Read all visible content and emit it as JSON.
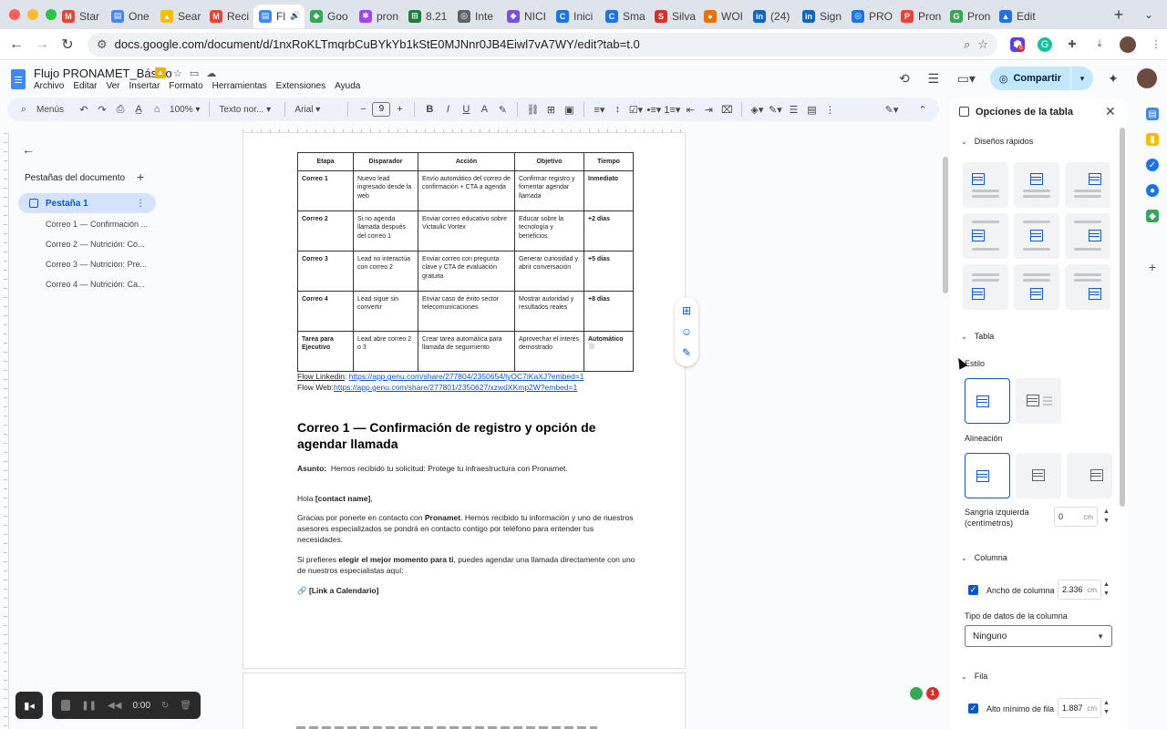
{
  "browser": {
    "tabs": [
      {
        "label": "Star",
        "color": "#ea4335",
        "glyph": "M"
      },
      {
        "label": "One",
        "color": "#4285f4",
        "glyph": "▤"
      },
      {
        "label": "Sear",
        "color": "#fbbc04",
        "glyph": "▲"
      },
      {
        "label": "Reci",
        "color": "#ea4335",
        "glyph": "M"
      },
      {
        "label": "Fl",
        "color": "#4285f4",
        "glyph": "▤",
        "active": true
      },
      {
        "label": "Goo",
        "color": "#34a853",
        "glyph": "◆"
      },
      {
        "label": "pron",
        "color": "#a142f4",
        "glyph": "✱"
      },
      {
        "label": "8.21",
        "color": "#188038",
        "glyph": "⊞"
      },
      {
        "label": "Inte",
        "color": "#5f6368",
        "glyph": "◎"
      },
      {
        "label": "NICI",
        "color": "#7b4ee2",
        "glyph": "◆"
      },
      {
        "label": "Inici",
        "color": "#1a73e8",
        "glyph": "C"
      },
      {
        "label": "Sma",
        "color": "#1a73e8",
        "glyph": "C"
      },
      {
        "label": "Silva",
        "color": "#d93025",
        "glyph": "S"
      },
      {
        "label": "WOI",
        "color": "#e8710a",
        "glyph": "●"
      },
      {
        "label": "(24)",
        "color": "#0a66c2",
        "glyph": "in"
      },
      {
        "label": "Sign",
        "color": "#0a66c2",
        "glyph": "in"
      },
      {
        "label": "PRO",
        "color": "#1a73e8",
        "glyph": "◎"
      },
      {
        "label": "Pron",
        "color": "#ea4335",
        "glyph": "P"
      },
      {
        "label": "Pron",
        "color": "#34a853",
        "glyph": "G"
      },
      {
        "label": "Edit",
        "color": "#1a73e8",
        "glyph": "▲"
      }
    ],
    "url": "docs.google.com/document/d/1nxRoKLTmqrbCuBYkYb1kStE0MJNnr0JB4Eiwl7vA7WY/edit?tab=t.0",
    "ext_badge": "6"
  },
  "docs": {
    "title": "Flujo PRONAMET_Básico",
    "menus": [
      "Archivo",
      "Editar",
      "Ver",
      "Insertar",
      "Formato",
      "Herramientas",
      "Extensiones",
      "Ayuda"
    ],
    "share_label": "Compartir"
  },
  "toolbar": {
    "search_menus": "Menús",
    "zoom": "100%",
    "style": "Texto nor...",
    "font": "Arial",
    "font_size": "9"
  },
  "outline": {
    "heading": "Pestañas del documento",
    "tab_label": "Pestaña 1",
    "items": [
      "Correo 1 — Confirmación ...",
      "Correo 2 — Nutrición: Có...",
      "Correo 3 — Nutrición: Pre...",
      "Correo 4 — Nutrición: Ca..."
    ]
  },
  "document": {
    "table": {
      "headers": [
        "Etapa",
        "Disparador",
        "Acción",
        "Objetivo",
        "Tiempo"
      ],
      "rows": [
        [
          "Correo 1",
          "Nuevo lead ingresado desde la web",
          "Envío automático del correo de confirmación + CTA a agenda",
          "Confirmar registro y fomentar agendar llamada",
          "Inmediato"
        ],
        [
          "Correo 2",
          "Si no agenda llamada después del correo 1",
          "Enviar correo educativo sobre Victaulic Vortex",
          "Educar sobre la tecnología y beneficios",
          "+2 días"
        ],
        [
          "Correo 3",
          "Lead no interactúa con correo 2",
          "Enviar correo con pregunta clave y CTA de evaluación gratuita",
          "Generar curiosidad y abrir conversación",
          "+5 días"
        ],
        [
          "Correo 4",
          "Lead sigue sin convertir",
          "Enviar caso de éxito sector telecomunicaciones",
          "Mostrar autoridad y resultados reales",
          "+8 días"
        ],
        [
          "Tarea para Ejecutivo",
          "Lead abre correo 2 o 3",
          "Crear tarea automática para llamada de seguimiento",
          "Aprovechar el interés demostrado",
          "Automático"
        ]
      ]
    },
    "flow_linkedin_label": "Flow Linkedin",
    "flow_linkedin_sep": ": ",
    "flow_linkedin_url": "https://app.genu.com/share/277804/2350654/lyOC7iKaXJ?embed=1",
    "flow_web_label": "Flow Web:",
    "flow_web_url": "https://app.genu.com/share/277801/2350627/xzwdXKmp2W?embed=1",
    "heading": "Correo 1 — Confirmación de registro y opción de agendar llamada",
    "asunto_label": "Asunto:",
    "asunto_text": "Hemos recibido tu solicitud: Protege tu infraestructura con Pronamet.",
    "greeting_pre": "Hola ",
    "greeting_name": "[contact name]",
    "greeting_post": ",",
    "p1_a": "Gracias por ponerte en contacto con ",
    "p1_b": "Pronamet",
    "p1_c": ". Hemos recibido tu información y uno de nuestros asesores especializados se pondrá en contacto contigo por teléfono para entender tus necesidades.",
    "p2_a": "Si prefieres ",
    "p2_b": "elegir el mejor momento para ti",
    "p2_c": ", puedes agendar una llamada directamente con uno de nuestros especialistas aquí:",
    "link_cal": "🔗 [Link a Calendario]"
  },
  "table_panel": {
    "title": "Opciones de la tabla",
    "quick_designs": "Diseños rápidos",
    "section_table": "Tabla",
    "estilo": "Estilo",
    "alineacion": "Alineación",
    "sangria": "Sangría izquierda (centímetros)",
    "sangria_value": "0",
    "unit_cm": "cm",
    "section_column": "Columna",
    "ancho_columna": "Ancho de columna",
    "ancho_value": "2.336",
    "tipo_datos": "Tipo de datos de la columna",
    "tipo_value": "Ninguno",
    "section_row": "Fila",
    "alto_fila": "Alto mínimo de fila",
    "alto_value": "1.887"
  },
  "recorder": {
    "time": "0:00"
  },
  "notifications": {
    "count": "1"
  },
  "colors": {
    "accent": "#0b57d0",
    "share_bg": "#c2e7ff",
    "link": "#1155cc"
  }
}
